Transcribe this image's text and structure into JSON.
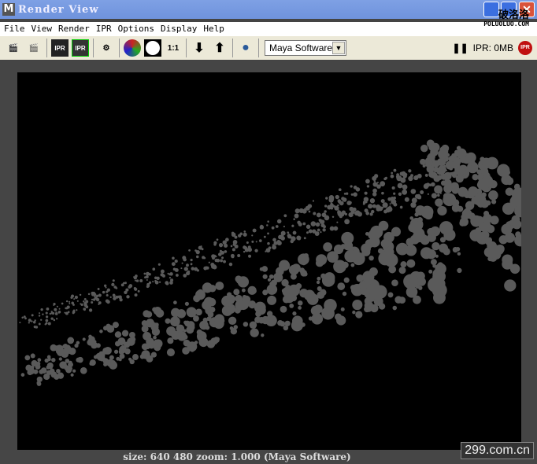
{
  "window": {
    "title": "Render View",
    "app_icon": "M"
  },
  "menu": [
    "File",
    "View",
    "Render",
    "IPR",
    "Options",
    "Display",
    "Help"
  ],
  "toolbar": {
    "ratio_label": "1:1",
    "renderer": "Maya Software",
    "ipr_status": "IPR: 0MB",
    "ipr_badge": "IPR"
  },
  "status": {
    "text": "size:  640  480 zoom: 1.000  (Maya Software)"
  },
  "watermarks": {
    "corner": "299.com.cn",
    "top_cn": "破洛洛",
    "top_url": "POLUOLUO.COM"
  }
}
